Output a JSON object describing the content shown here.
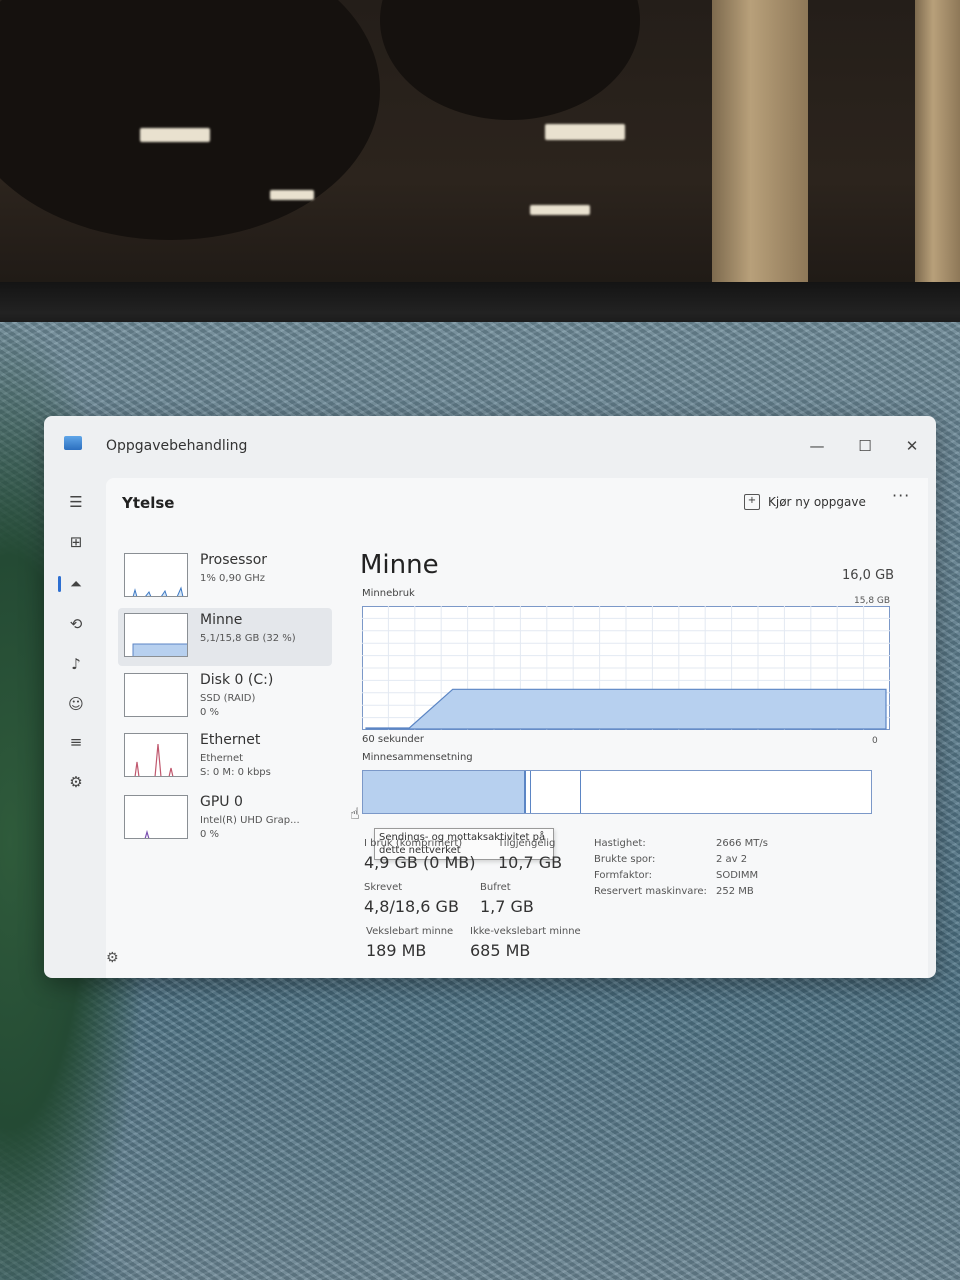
{
  "window": {
    "title": "Oppgavebehandling",
    "page_title": "Ytelse",
    "run_task_label": "Kjør ny oppgave",
    "more_label": "···"
  },
  "controls": {
    "minimize": "—",
    "maximize": "☐",
    "close": "✕"
  },
  "nav": [
    {
      "name": "hamburger-menu-icon",
      "glyph": "☰"
    },
    {
      "name": "processes-icon",
      "glyph": "⊞"
    },
    {
      "name": "performance-icon",
      "glyph": "⏶"
    },
    {
      "name": "app-history-icon",
      "glyph": "⟲"
    },
    {
      "name": "startup-apps-icon",
      "glyph": "♪"
    },
    {
      "name": "users-icon",
      "glyph": "☺"
    },
    {
      "name": "details-icon",
      "glyph": "≡"
    },
    {
      "name": "services-icon",
      "glyph": "⚙"
    }
  ],
  "devices": [
    {
      "name": "Prosessor",
      "sub1": "1% 0,90 GHz",
      "sub2": "",
      "sub3": ""
    },
    {
      "name": "Minne",
      "sub1": "5,1/15,8 GB (32 %)",
      "sub2": "",
      "sub3": ""
    },
    {
      "name": "Disk 0 (C:)",
      "sub1": "SSD (RAID)",
      "sub2": "0 %",
      "sub3": ""
    },
    {
      "name": "Ethernet",
      "sub1": "Ethernet",
      "sub2": "S: 0 M: 0 kbps",
      "sub3": ""
    },
    {
      "name": "GPU 0",
      "sub1": "Intel(R) UHD Grap...",
      "sub2": "0 %",
      "sub3": ""
    }
  ],
  "tooltip": {
    "line1": "Sendings- og mottaksaktivitet på",
    "line2": "dette nettverket"
  },
  "memory": {
    "title": "Minne",
    "total": "16,0 GB",
    "usage_label": "Minnebruk",
    "usage_max": "15,8 GB",
    "time_label": "60 sekunder",
    "time_zero": "0",
    "composition_label": "Minnesammensetning",
    "composition": {
      "in_use_fraction": 0.32,
      "modified_fraction": 0.01,
      "standby_fraction": 0.1
    },
    "stats": {
      "in_use_label": "I bruk (komprimert)",
      "in_use_value": "4,9 GB (0 MB)",
      "available_label": "Tilgjengelig",
      "available_value": "10,7 GB",
      "committed_label": "Skrevet",
      "committed_value": "4,8/18,6 GB",
      "cached_label": "Bufret",
      "cached_value": "1,7 GB",
      "paged_label": "Vekslebart minne",
      "paged_value": "189 MB",
      "nonpaged_label": "Ikke-vekslebart minne",
      "nonpaged_value": "685 MB"
    },
    "specs": [
      {
        "label": "Hastighet:",
        "value": "2666 MT/s"
      },
      {
        "label": "Brukte spor:",
        "value": "2 av 2"
      },
      {
        "label": "Formfaktor:",
        "value": "SODIMM"
      },
      {
        "label": "Reservert maskinvare:",
        "value": "252 MB"
      }
    ]
  },
  "chart_data": {
    "type": "area",
    "title": "Minnebruk",
    "xlabel": "60 sekunder",
    "ylabel": "",
    "x": [
      60,
      55,
      50,
      45,
      40,
      35,
      30,
      25,
      20,
      15,
      10,
      5,
      0
    ],
    "values": [
      0,
      0,
      5.1,
      5.1,
      5.1,
      5.1,
      5.1,
      5.1,
      5.1,
      5.1,
      5.1,
      5.1,
      5.1
    ],
    "ylim": [
      0,
      15.8
    ],
    "xlim": [
      60,
      0
    ],
    "grid": true
  },
  "colors": {
    "accent": "#2d6fd1",
    "memory_fill": "#b7d0ef",
    "memory_line": "#5b85c4"
  }
}
